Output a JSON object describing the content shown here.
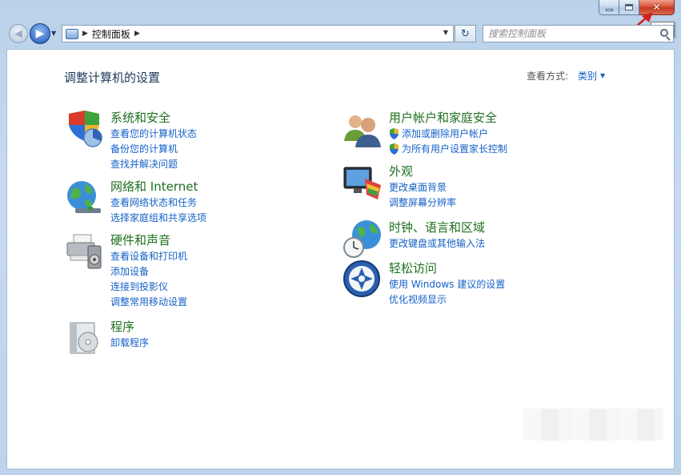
{
  "window": {
    "caption": {
      "close_tooltip": "关闭"
    }
  },
  "address_bar": {
    "crumbs": [
      "控制面板"
    ],
    "search_placeholder": "搜索控制面板"
  },
  "content": {
    "title": "调整计算机的设置",
    "view_by_label": "查看方式:",
    "view_by_value": "类别"
  },
  "categories_left": [
    {
      "title": "系统和安全",
      "icon": "system-security-icon",
      "links": [
        "查看您的计算机状态",
        "备份您的计算机",
        "查找并解决问题"
      ]
    },
    {
      "title": "网络和 Internet",
      "icon": "network-icon",
      "links": [
        "查看网络状态和任务",
        "选择家庭组和共享选项"
      ]
    },
    {
      "title": "硬件和声音",
      "icon": "hardware-sound-icon",
      "links": [
        "查看设备和打印机",
        "添加设备",
        "连接到投影仪",
        "调整常用移动设置"
      ]
    },
    {
      "title": "程序",
      "icon": "programs-icon",
      "links": [
        "卸载程序"
      ]
    }
  ],
  "categories_right": [
    {
      "title": "用户帐户和家庭安全",
      "icon": "user-accounts-icon",
      "links": [
        "添加或删除用户帐户",
        "为所有用户设置家长控制"
      ]
    },
    {
      "title": "外观",
      "icon": "appearance-icon",
      "links": [
        "更改桌面背景",
        "调整屏幕分辨率"
      ]
    },
    {
      "title": "时钟、语言和区域",
      "icon": "clock-language-icon",
      "links": [
        "更改键盘或其他输入法"
      ]
    },
    {
      "title": "轻松访问",
      "icon": "ease-of-access-icon",
      "links": [
        "使用 Windows 建议的设置",
        "优化视频显示"
      ]
    }
  ],
  "colors": {
    "category_title": "#1e6e1e",
    "link": "#1561c7",
    "close_button": "#c43a22"
  }
}
